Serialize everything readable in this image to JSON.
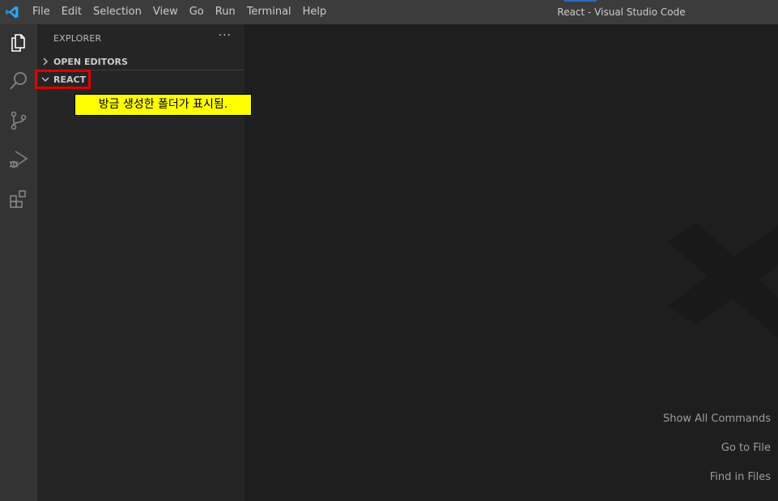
{
  "titlebar": {
    "menu": [
      "File",
      "Edit",
      "Selection",
      "View",
      "Go",
      "Run",
      "Terminal",
      "Help"
    ],
    "window_title": "React - Visual Studio Code"
  },
  "activitybar": {
    "icons": [
      "explorer-icon",
      "search-icon",
      "source-control-icon",
      "run-debug-icon",
      "extensions-icon"
    ]
  },
  "sidebar": {
    "title": "EXPLORER",
    "more": "···",
    "sections": [
      {
        "label": "OPEN EDITORS",
        "expanded": false
      },
      {
        "label": "REACT",
        "expanded": true
      }
    ]
  },
  "annotation": {
    "text": "방금 생성한 폴더가 표시됨."
  },
  "editor": {
    "shortcuts": [
      "Show All Commands",
      "Go to File",
      "Find in Files"
    ]
  },
  "colors": {
    "highlight": "#e00000",
    "annotation_bg": "#ffff00",
    "accent": "#007acc"
  }
}
